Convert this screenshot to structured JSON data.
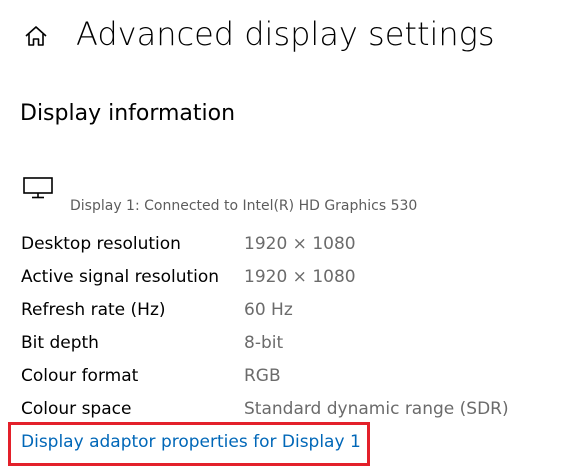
{
  "header": {
    "home_icon": "home-icon",
    "title": "Advanced display settings"
  },
  "display_information": {
    "section_title": "Display information",
    "display_icon": "monitor-icon",
    "display_caption": "Display 1: Connected to Intel(R) HD Graphics 530",
    "rows": [
      {
        "label": "Desktop resolution",
        "value": "1920 × 1080"
      },
      {
        "label": "Active signal resolution",
        "value": "1920 × 1080"
      },
      {
        "label": "Refresh rate (Hz)",
        "value": "60 Hz"
      },
      {
        "label": "Bit depth",
        "value": "8-bit"
      },
      {
        "label": "Colour format",
        "value": "RGB"
      },
      {
        "label": "Colour space",
        "value": "Standard dynamic range (SDR)"
      }
    ],
    "adaptor_link": "Display adaptor properties for Display 1"
  },
  "colors": {
    "link": "#0067b8",
    "highlight_border": "#e3202a",
    "secondary_text": "#6b6b6b"
  }
}
